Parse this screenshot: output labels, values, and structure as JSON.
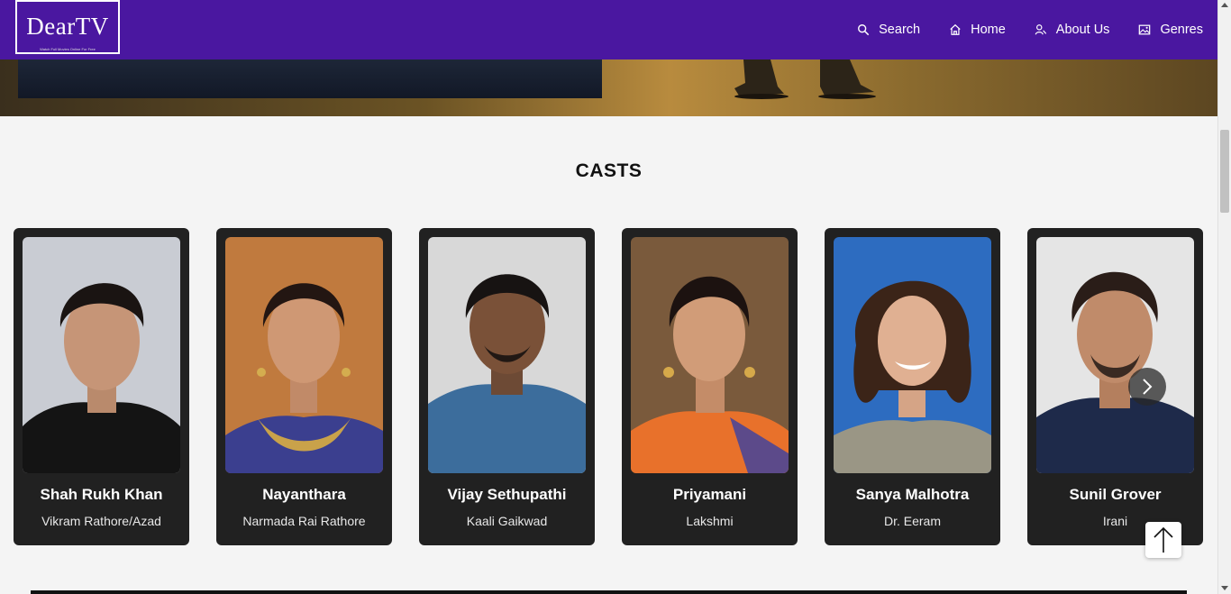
{
  "header": {
    "logo_name": "DearTV",
    "logo_tagline": "Watch Full Movies Online For Free",
    "nav": [
      {
        "label": "Search",
        "icon": "search-icon"
      },
      {
        "label": "Home",
        "icon": "home-icon"
      },
      {
        "label": "About Us",
        "icon": "about-us-icon"
      },
      {
        "label": "Genres",
        "icon": "genres-icon"
      }
    ],
    "color": "#4a17a0"
  },
  "casts": {
    "title": "CASTS",
    "items": [
      {
        "name": "Shah Rukh Khan",
        "role": "Vikram Rathore/Azad"
      },
      {
        "name": "Nayanthara",
        "role": "Narmada Rai Rathore"
      },
      {
        "name": "Vijay Sethupathi",
        "role": "Kaali Gaikwad"
      },
      {
        "name": "Priyamani",
        "role": "Lakshmi"
      },
      {
        "name": "Sanya Malhotra",
        "role": "Dr. Eeram"
      },
      {
        "name": "Sunil Grover",
        "role": "Irani"
      }
    ]
  },
  "controls": {
    "next_icon": "chevron-right-icon",
    "back_to_top_icon": "arrow-up-icon"
  }
}
